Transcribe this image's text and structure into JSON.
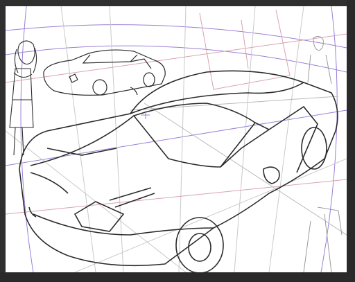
{
  "app": {
    "background_color": "#2f2f2f",
    "canvas_color": "#ffffff"
  },
  "sketch": {
    "subjects": [
      "sports-car-foreground",
      "sports-car-background",
      "girl-standing-left",
      "person-standing-right"
    ],
    "guide_line_colors": {
      "perspective_purple": "#9a7fd6",
      "construction_pink": "#d8a3b0",
      "construction_gray": "#b9b9b9",
      "ink": "#2b2b2b"
    }
  }
}
